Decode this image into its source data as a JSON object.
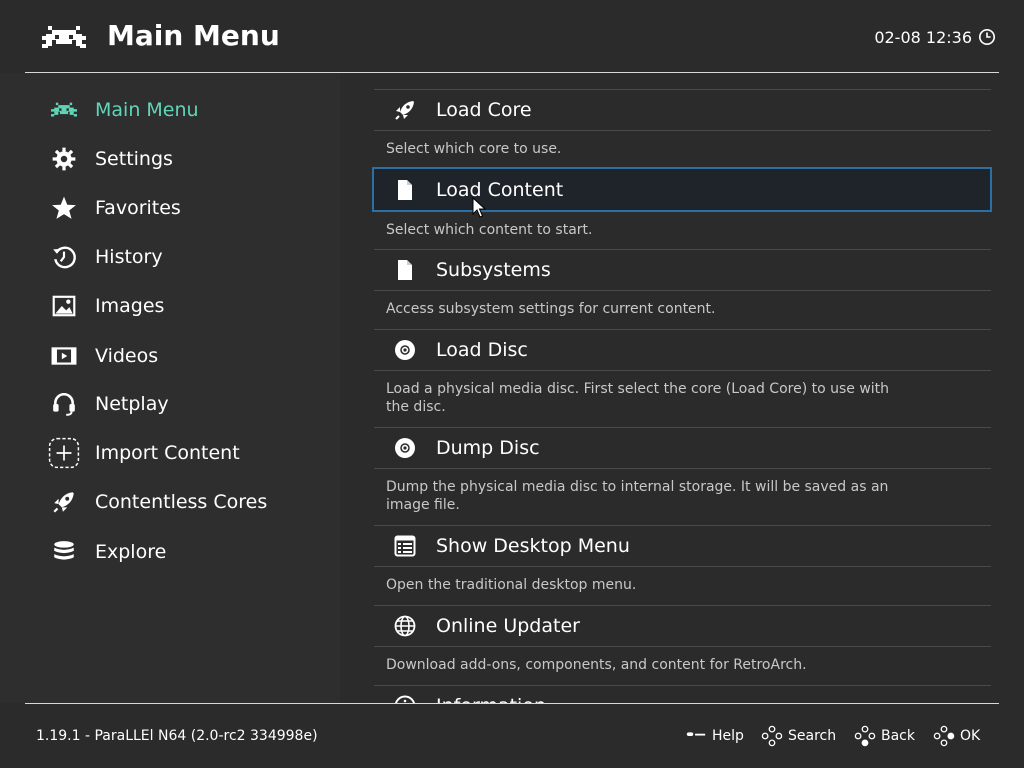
{
  "header": {
    "title": "Main Menu",
    "datetime": "02-08 12:36",
    "logo_icon": "retroarch-invader-logo",
    "clock_icon": "clock-icon"
  },
  "sidebar": {
    "items": [
      {
        "label": "Main Menu",
        "icon": "invader-icon",
        "active": true
      },
      {
        "label": "Settings",
        "icon": "gear-icon"
      },
      {
        "label": "Favorites",
        "icon": "star-icon"
      },
      {
        "label": "History",
        "icon": "history-icon"
      },
      {
        "label": "Images",
        "icon": "image-icon"
      },
      {
        "label": "Videos",
        "icon": "film-icon"
      },
      {
        "label": "Netplay",
        "icon": "headset-icon"
      },
      {
        "label": "Import Content",
        "icon": "add-icon"
      },
      {
        "label": "Contentless Cores",
        "icon": "rocket-icon"
      },
      {
        "label": "Explore",
        "icon": "database-icon"
      }
    ]
  },
  "menu": {
    "entries": [
      {
        "label": "Load Core",
        "desc": "Select which core to use.",
        "icon": "rocket-icon"
      },
      {
        "label": "Load Content",
        "desc": "Select which content to start.",
        "icon": "file-icon",
        "selected": true
      },
      {
        "label": "Subsystems",
        "desc": "Access subsystem settings for current content.",
        "icon": "file-icon"
      },
      {
        "label": "Load Disc",
        "desc": "Load a physical media disc. First select the core (Load Core) to use with the disc.",
        "icon": "disc-icon"
      },
      {
        "label": "Dump Disc",
        "desc": "Dump the physical media disc to internal storage. It will be saved as an image file.",
        "icon": "disc-icon"
      },
      {
        "label": "Show Desktop Menu",
        "desc": "Open the traditional desktop menu.",
        "icon": "desktop-menu-icon"
      },
      {
        "label": "Online Updater",
        "desc": "Download add-ons, components, and content for RetroArch.",
        "icon": "globe-icon"
      },
      {
        "label": "Information",
        "desc": "",
        "icon": "info-icon"
      }
    ]
  },
  "footer": {
    "version": "1.19.1 - ParaLLEl N64 (2.0-rc2 334998e)",
    "hints": [
      {
        "label": "Help",
        "icon": "select-button-icon"
      },
      {
        "label": "Search",
        "icon": "dpad-icon"
      },
      {
        "label": "Back",
        "icon": "dpad-icon"
      },
      {
        "label": "OK",
        "icon": "dpad-icon"
      }
    ]
  },
  "colors": {
    "background": "#2b2b2b",
    "sidebar_bg": "#2e2e2e",
    "active_accent": "#5fd6b7",
    "selection_border": "#2b6fa4",
    "text": "#ffffff",
    "desc_text": "#c8c8c8"
  }
}
